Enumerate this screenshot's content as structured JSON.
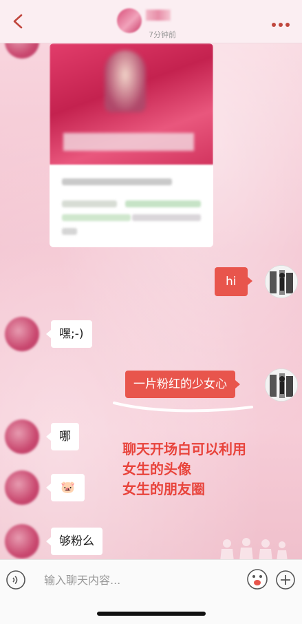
{
  "header": {
    "time_ago": "7分钟前",
    "icons": {
      "back": "chevron-left-icon",
      "more": "more-dots-icon"
    },
    "accent_color": "#c0463d"
  },
  "messages": [
    {
      "side": "left",
      "type": "shared-moment-card"
    },
    {
      "side": "right",
      "text": "hi"
    },
    {
      "side": "left",
      "text": "嘿;-)"
    },
    {
      "side": "right",
      "text": "一片粉红的少女心"
    },
    {
      "side": "left",
      "text": "哪"
    },
    {
      "side": "left",
      "text": "🐷"
    },
    {
      "side": "left",
      "text": "够粉么"
    }
  ],
  "annotation": {
    "line1": "聊天开场白可以利用",
    "line2": "女生的头像",
    "line3": "女生的朋友圈",
    "color": "#e8443c"
  },
  "input": {
    "placeholder": "输入聊天内容...",
    "value": ""
  },
  "colors": {
    "outgoing_bubble": "#e8554c",
    "incoming_bubble": "#ffffff",
    "chat_background": "#f5c9d4"
  }
}
